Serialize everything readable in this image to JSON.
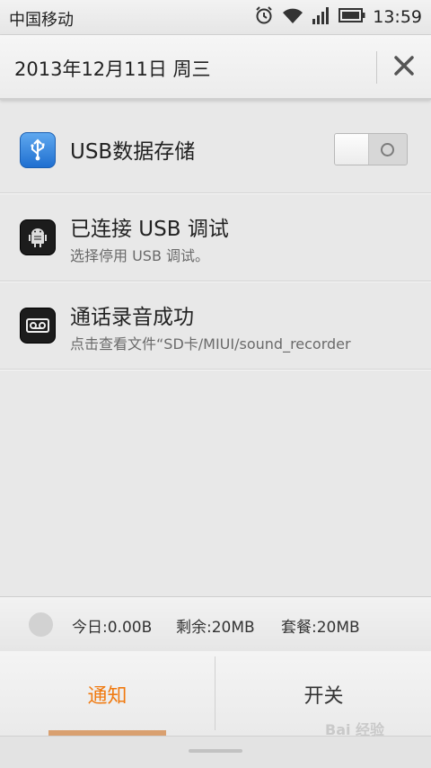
{
  "status_bar": {
    "carrier": "中国移动",
    "time": "13:59",
    "icons": [
      "alarm-icon",
      "wifi-icon",
      "signal-icon",
      "battery-icon"
    ]
  },
  "header": {
    "date": "2013年12月11日 周三",
    "close_icon": "close-icon"
  },
  "notifications": [
    {
      "icon": "usb-icon",
      "title": "USB数据存储",
      "toggle_on": false
    },
    {
      "icon": "android-debug-icon",
      "title": "已连接 USB 调试",
      "subtitle": "选择停用 USB 调试。"
    },
    {
      "icon": "voice-record-icon",
      "title": "通话录音成功",
      "subtitle": "点击查看文件“SD卡/MIUI/sound_recorder"
    }
  ],
  "data_usage": {
    "today": "今日:0.00B",
    "remaining": "剩余:20MB",
    "plan": "套餐:20MB"
  },
  "tabs": [
    {
      "label": "通知",
      "active": true
    },
    {
      "label": "开关",
      "active": false
    }
  ],
  "colors": {
    "accent": "#f07a10",
    "indicator": "#d9a070"
  },
  "watermark": "Bai 经验"
}
